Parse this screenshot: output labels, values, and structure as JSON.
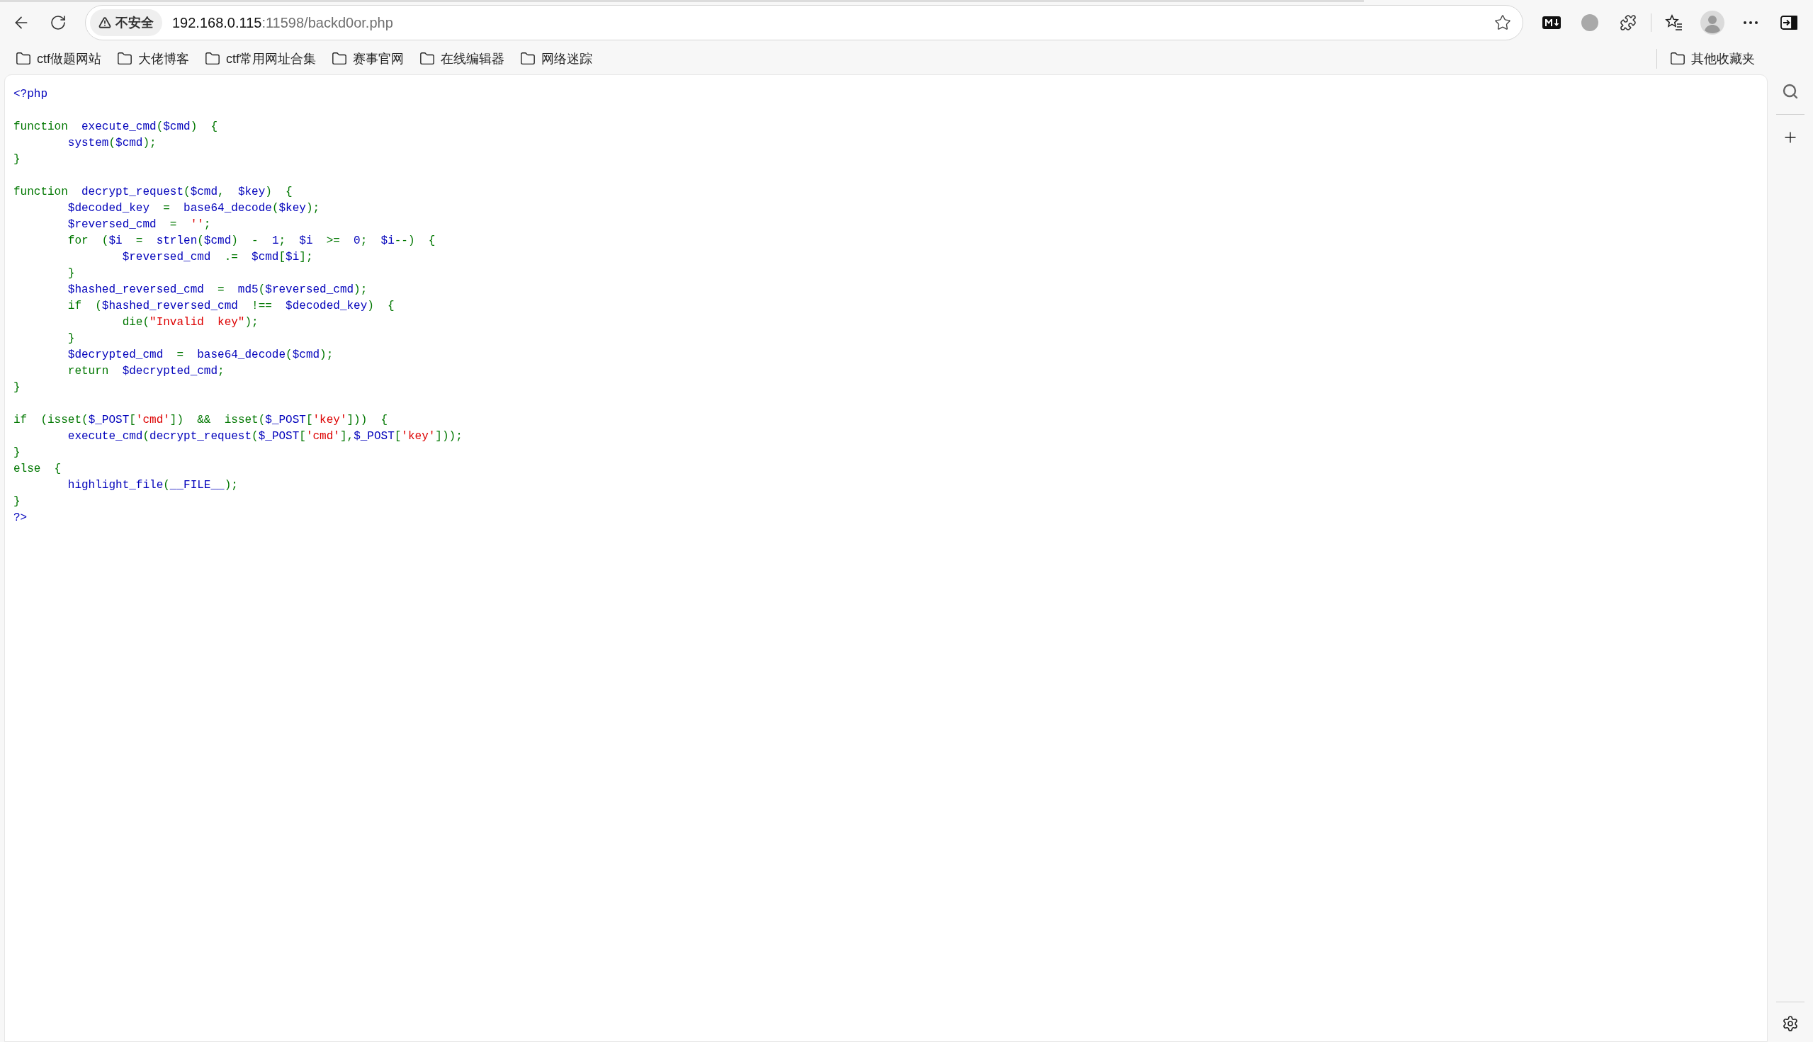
{
  "address_bar": {
    "security_label": "不安全",
    "host": "192.168.0.115",
    "path": ":11598/backd0or.php"
  },
  "bookmarks": [
    "ctf做题网站",
    "大佬博客",
    "ctf常用网址合集",
    "赛事官网",
    "在线编辑器",
    "网络迷踪"
  ],
  "other_bookmarks": "其他收藏夹",
  "code_blocks": [
    [
      {
        "tokens": [
          {
            "kind": "default",
            "text": "<?php"
          }
        ]
      }
    ],
    [
      {
        "tokens": [
          {
            "kind": "keyword",
            "text": "function  "
          },
          {
            "kind": "default",
            "text": "execute_cmd"
          },
          {
            "kind": "keyword",
            "text": "("
          },
          {
            "kind": "default",
            "text": "$cmd"
          },
          {
            "kind": "keyword",
            "text": ")  {"
          }
        ]
      },
      {
        "tokens": [
          {
            "kind": "default",
            "text": "        system"
          },
          {
            "kind": "keyword",
            "text": "("
          },
          {
            "kind": "default",
            "text": "$cmd"
          },
          {
            "kind": "keyword",
            "text": ");"
          }
        ]
      },
      {
        "tokens": [
          {
            "kind": "keyword",
            "text": "}"
          }
        ]
      }
    ],
    [
      {
        "tokens": [
          {
            "kind": "keyword",
            "text": "function  "
          },
          {
            "kind": "default",
            "text": "decrypt_request"
          },
          {
            "kind": "keyword",
            "text": "("
          },
          {
            "kind": "default",
            "text": "$cmd"
          },
          {
            "kind": "keyword",
            "text": ",  "
          },
          {
            "kind": "default",
            "text": "$key"
          },
          {
            "kind": "keyword",
            "text": ")  {"
          }
        ]
      },
      {
        "tokens": [
          {
            "kind": "default",
            "text": "        $decoded_key  "
          },
          {
            "kind": "keyword",
            "text": "=  "
          },
          {
            "kind": "default",
            "text": "base64_decode"
          },
          {
            "kind": "keyword",
            "text": "("
          },
          {
            "kind": "default",
            "text": "$key"
          },
          {
            "kind": "keyword",
            "text": ");"
          }
        ]
      },
      {
        "tokens": [
          {
            "kind": "default",
            "text": "        $reversed_cmd  "
          },
          {
            "kind": "keyword",
            "text": "=  "
          },
          {
            "kind": "string",
            "text": "''"
          },
          {
            "kind": "keyword",
            "text": ";"
          }
        ]
      },
      {
        "tokens": [
          {
            "kind": "keyword",
            "text": "        for  ("
          },
          {
            "kind": "default",
            "text": "$i  "
          },
          {
            "kind": "keyword",
            "text": "=  "
          },
          {
            "kind": "default",
            "text": "strlen"
          },
          {
            "kind": "keyword",
            "text": "("
          },
          {
            "kind": "default",
            "text": "$cmd"
          },
          {
            "kind": "keyword",
            "text": ")  -  "
          },
          {
            "kind": "default",
            "text": "1"
          },
          {
            "kind": "keyword",
            "text": ";  "
          },
          {
            "kind": "default",
            "text": "$i  "
          },
          {
            "kind": "keyword",
            "text": ">=  "
          },
          {
            "kind": "default",
            "text": "0"
          },
          {
            "kind": "keyword",
            "text": ";  "
          },
          {
            "kind": "default",
            "text": "$i"
          },
          {
            "kind": "keyword",
            "text": "--)  {"
          }
        ]
      },
      {
        "tokens": [
          {
            "kind": "default",
            "text": "                $reversed_cmd  "
          },
          {
            "kind": "keyword",
            "text": ".=  "
          },
          {
            "kind": "default",
            "text": "$cmd"
          },
          {
            "kind": "keyword",
            "text": "["
          },
          {
            "kind": "default",
            "text": "$i"
          },
          {
            "kind": "keyword",
            "text": "];"
          }
        ]
      },
      {
        "tokens": [
          {
            "kind": "keyword",
            "text": "        }"
          }
        ]
      },
      {
        "tokens": [
          {
            "kind": "default",
            "text": "        $hashed_reversed_cmd  "
          },
          {
            "kind": "keyword",
            "text": "=  "
          },
          {
            "kind": "default",
            "text": "md5"
          },
          {
            "kind": "keyword",
            "text": "("
          },
          {
            "kind": "default",
            "text": "$reversed_cmd"
          },
          {
            "kind": "keyword",
            "text": ");"
          }
        ]
      },
      {
        "tokens": [
          {
            "kind": "keyword",
            "text": "        if  ("
          },
          {
            "kind": "default",
            "text": "$hashed_reversed_cmd  "
          },
          {
            "kind": "keyword",
            "text": "!==  "
          },
          {
            "kind": "default",
            "text": "$decoded_key"
          },
          {
            "kind": "keyword",
            "text": ")  {"
          }
        ]
      },
      {
        "tokens": [
          {
            "kind": "keyword",
            "text": "                die("
          },
          {
            "kind": "string",
            "text": "\"Invalid  key\""
          },
          {
            "kind": "keyword",
            "text": ");"
          }
        ]
      },
      {
        "tokens": [
          {
            "kind": "keyword",
            "text": "        }"
          }
        ]
      },
      {
        "tokens": [
          {
            "kind": "default",
            "text": "        $decrypted_cmd  "
          },
          {
            "kind": "keyword",
            "text": "=  "
          },
          {
            "kind": "default",
            "text": "base64_decode"
          },
          {
            "kind": "keyword",
            "text": "("
          },
          {
            "kind": "default",
            "text": "$cmd"
          },
          {
            "kind": "keyword",
            "text": ");"
          }
        ]
      },
      {
        "tokens": [
          {
            "kind": "keyword",
            "text": "        return  "
          },
          {
            "kind": "default",
            "text": "$decrypted_cmd"
          },
          {
            "kind": "keyword",
            "text": ";"
          }
        ]
      },
      {
        "tokens": [
          {
            "kind": "keyword",
            "text": "}"
          }
        ]
      }
    ],
    [
      {
        "tokens": [
          {
            "kind": "keyword",
            "text": "if  (isset("
          },
          {
            "kind": "default",
            "text": "$_POST"
          },
          {
            "kind": "keyword",
            "text": "["
          },
          {
            "kind": "string",
            "text": "'cmd'"
          },
          {
            "kind": "keyword",
            "text": "])  &&  isset("
          },
          {
            "kind": "default",
            "text": "$_POST"
          },
          {
            "kind": "keyword",
            "text": "["
          },
          {
            "kind": "string",
            "text": "'key'"
          },
          {
            "kind": "keyword",
            "text": "]))  {"
          }
        ]
      },
      {
        "tokens": [
          {
            "kind": "default",
            "text": "        execute_cmd"
          },
          {
            "kind": "keyword",
            "text": "("
          },
          {
            "kind": "default",
            "text": "decrypt_request"
          },
          {
            "kind": "keyword",
            "text": "("
          },
          {
            "kind": "default",
            "text": "$_POST"
          },
          {
            "kind": "keyword",
            "text": "["
          },
          {
            "kind": "string",
            "text": "'cmd'"
          },
          {
            "kind": "keyword",
            "text": "],"
          },
          {
            "kind": "default",
            "text": "$_POST"
          },
          {
            "kind": "keyword",
            "text": "["
          },
          {
            "kind": "string",
            "text": "'key'"
          },
          {
            "kind": "keyword",
            "text": "]));"
          }
        ]
      },
      {
        "tokens": [
          {
            "kind": "keyword",
            "text": "}"
          }
        ]
      },
      {
        "tokens": [
          {
            "kind": "keyword",
            "text": "else  {"
          }
        ]
      },
      {
        "tokens": [
          {
            "kind": "default",
            "text": "        highlight_file"
          },
          {
            "kind": "keyword",
            "text": "("
          },
          {
            "kind": "default",
            "text": "__FILE__"
          },
          {
            "kind": "keyword",
            "text": ");"
          }
        ]
      },
      {
        "tokens": [
          {
            "kind": "keyword",
            "text": "}"
          }
        ]
      },
      {
        "tokens": [
          {
            "kind": "default",
            "text": "?>"
          }
        ]
      }
    ]
  ]
}
